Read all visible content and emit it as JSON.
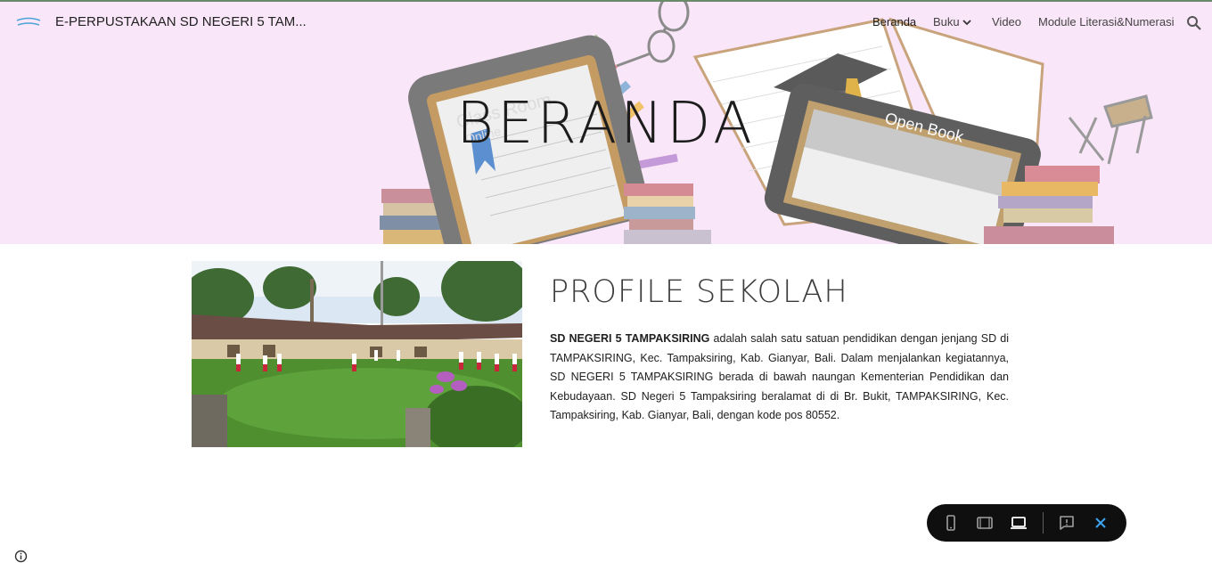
{
  "header": {
    "site_title": "E-PERPUSTAKAAN SD NEGERI 5 TAM...",
    "logo_icon": "school-logo-icon",
    "nav": [
      {
        "label": "Beranda",
        "active": true
      },
      {
        "label": "Buku",
        "has_dropdown": true
      },
      {
        "label": "Video"
      },
      {
        "label": "Module Literasi&Numerasi"
      }
    ],
    "search_icon": "search-icon"
  },
  "hero": {
    "title": "BERANDA",
    "bg_color": "#f9e6f8",
    "art_text": [
      "Class Room",
      "Online",
      "Open Book"
    ]
  },
  "profile": {
    "title": "PROFILE SEKOLAH",
    "school_name": "SD NEGERI 5 TAMPAKSIRING",
    "body": " adalah salah satu satuan pendidikan dengan jenjang SD di TAMPAKSIRING, Kec. Tampaksiring, Kab. Gianyar, Bali. Dalam menjalankan kegiatannya, SD NEGERI 5 TAMPAKSIRING berada di bawah naungan Kementerian Pendidikan dan Kebudayaan. SD Negeri 5 Tampaksiring beralamat di di Br. Bukit, TAMPAKSIRING, Kec. Tampaksiring, Kab. Gianyar, Bali, dengan kode pos 80552."
  },
  "view_toolbar": {
    "buttons": [
      "phone-view-icon",
      "tablet-view-icon",
      "laptop-view-icon",
      "report-abuse-icon",
      "close-icon"
    ],
    "active": "laptop-view-icon",
    "close_color": "#3ba3f0"
  },
  "footer": {
    "info_icon": "info-icon"
  }
}
